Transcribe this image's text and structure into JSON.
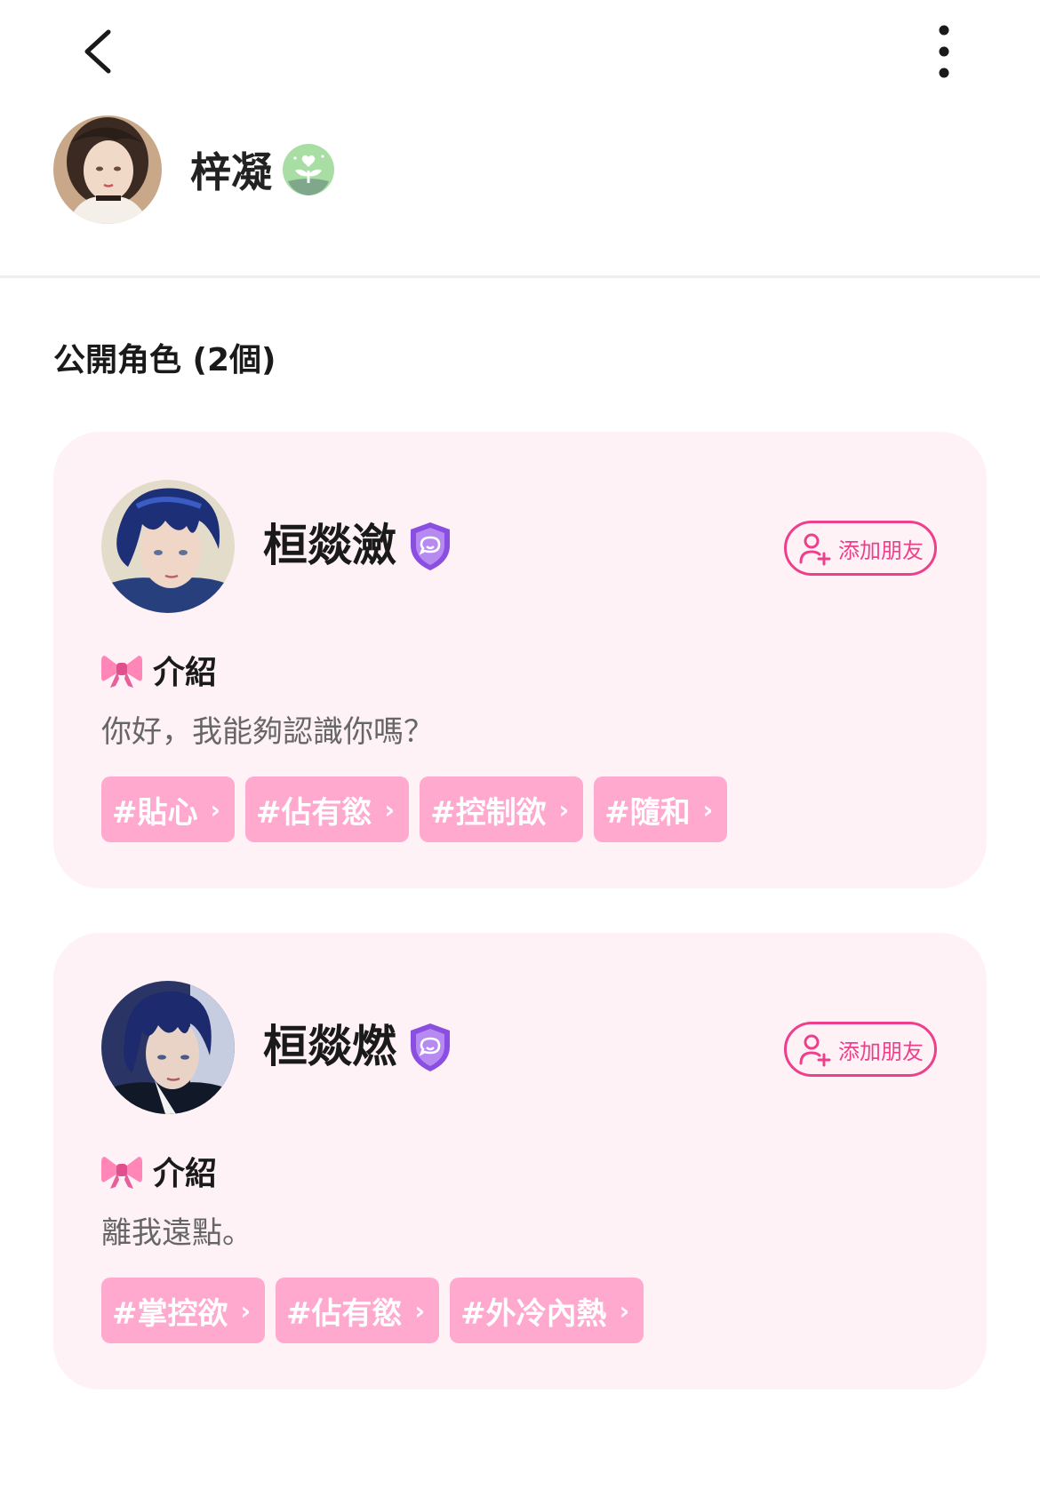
{
  "header": {
    "back_icon": "chevron-left-icon",
    "more_icon": "vertical-dots-icon"
  },
  "profile": {
    "username": "梓凝",
    "badge_icon": "sprout-heart-icon"
  },
  "section": {
    "title": "公開角色 (2個)"
  },
  "characters": [
    {
      "name": "桓燚瀲",
      "verified_icon": "purple-shield-icon",
      "add_friend_label": "添加朋友",
      "intro_label": "介紹",
      "intro_text": "你好，我能夠認識你嗎？",
      "tags": [
        "#貼心",
        "#佔有慾",
        "#控制欲",
        "#隨和"
      ]
    },
    {
      "name": "桓燚燃",
      "verified_icon": "purple-shield-icon",
      "add_friend_label": "添加朋友",
      "intro_label": "介紹",
      "intro_text": "離我遠點。",
      "tags": [
        "#掌控欲",
        "#佔有慾",
        "#外冷內熱"
      ]
    }
  ],
  "colors": {
    "accent": "#ee3f8c",
    "tag_bg": "#ffa9cf",
    "card_bg": "#fff2f7",
    "shield": "#8a4fe0"
  }
}
